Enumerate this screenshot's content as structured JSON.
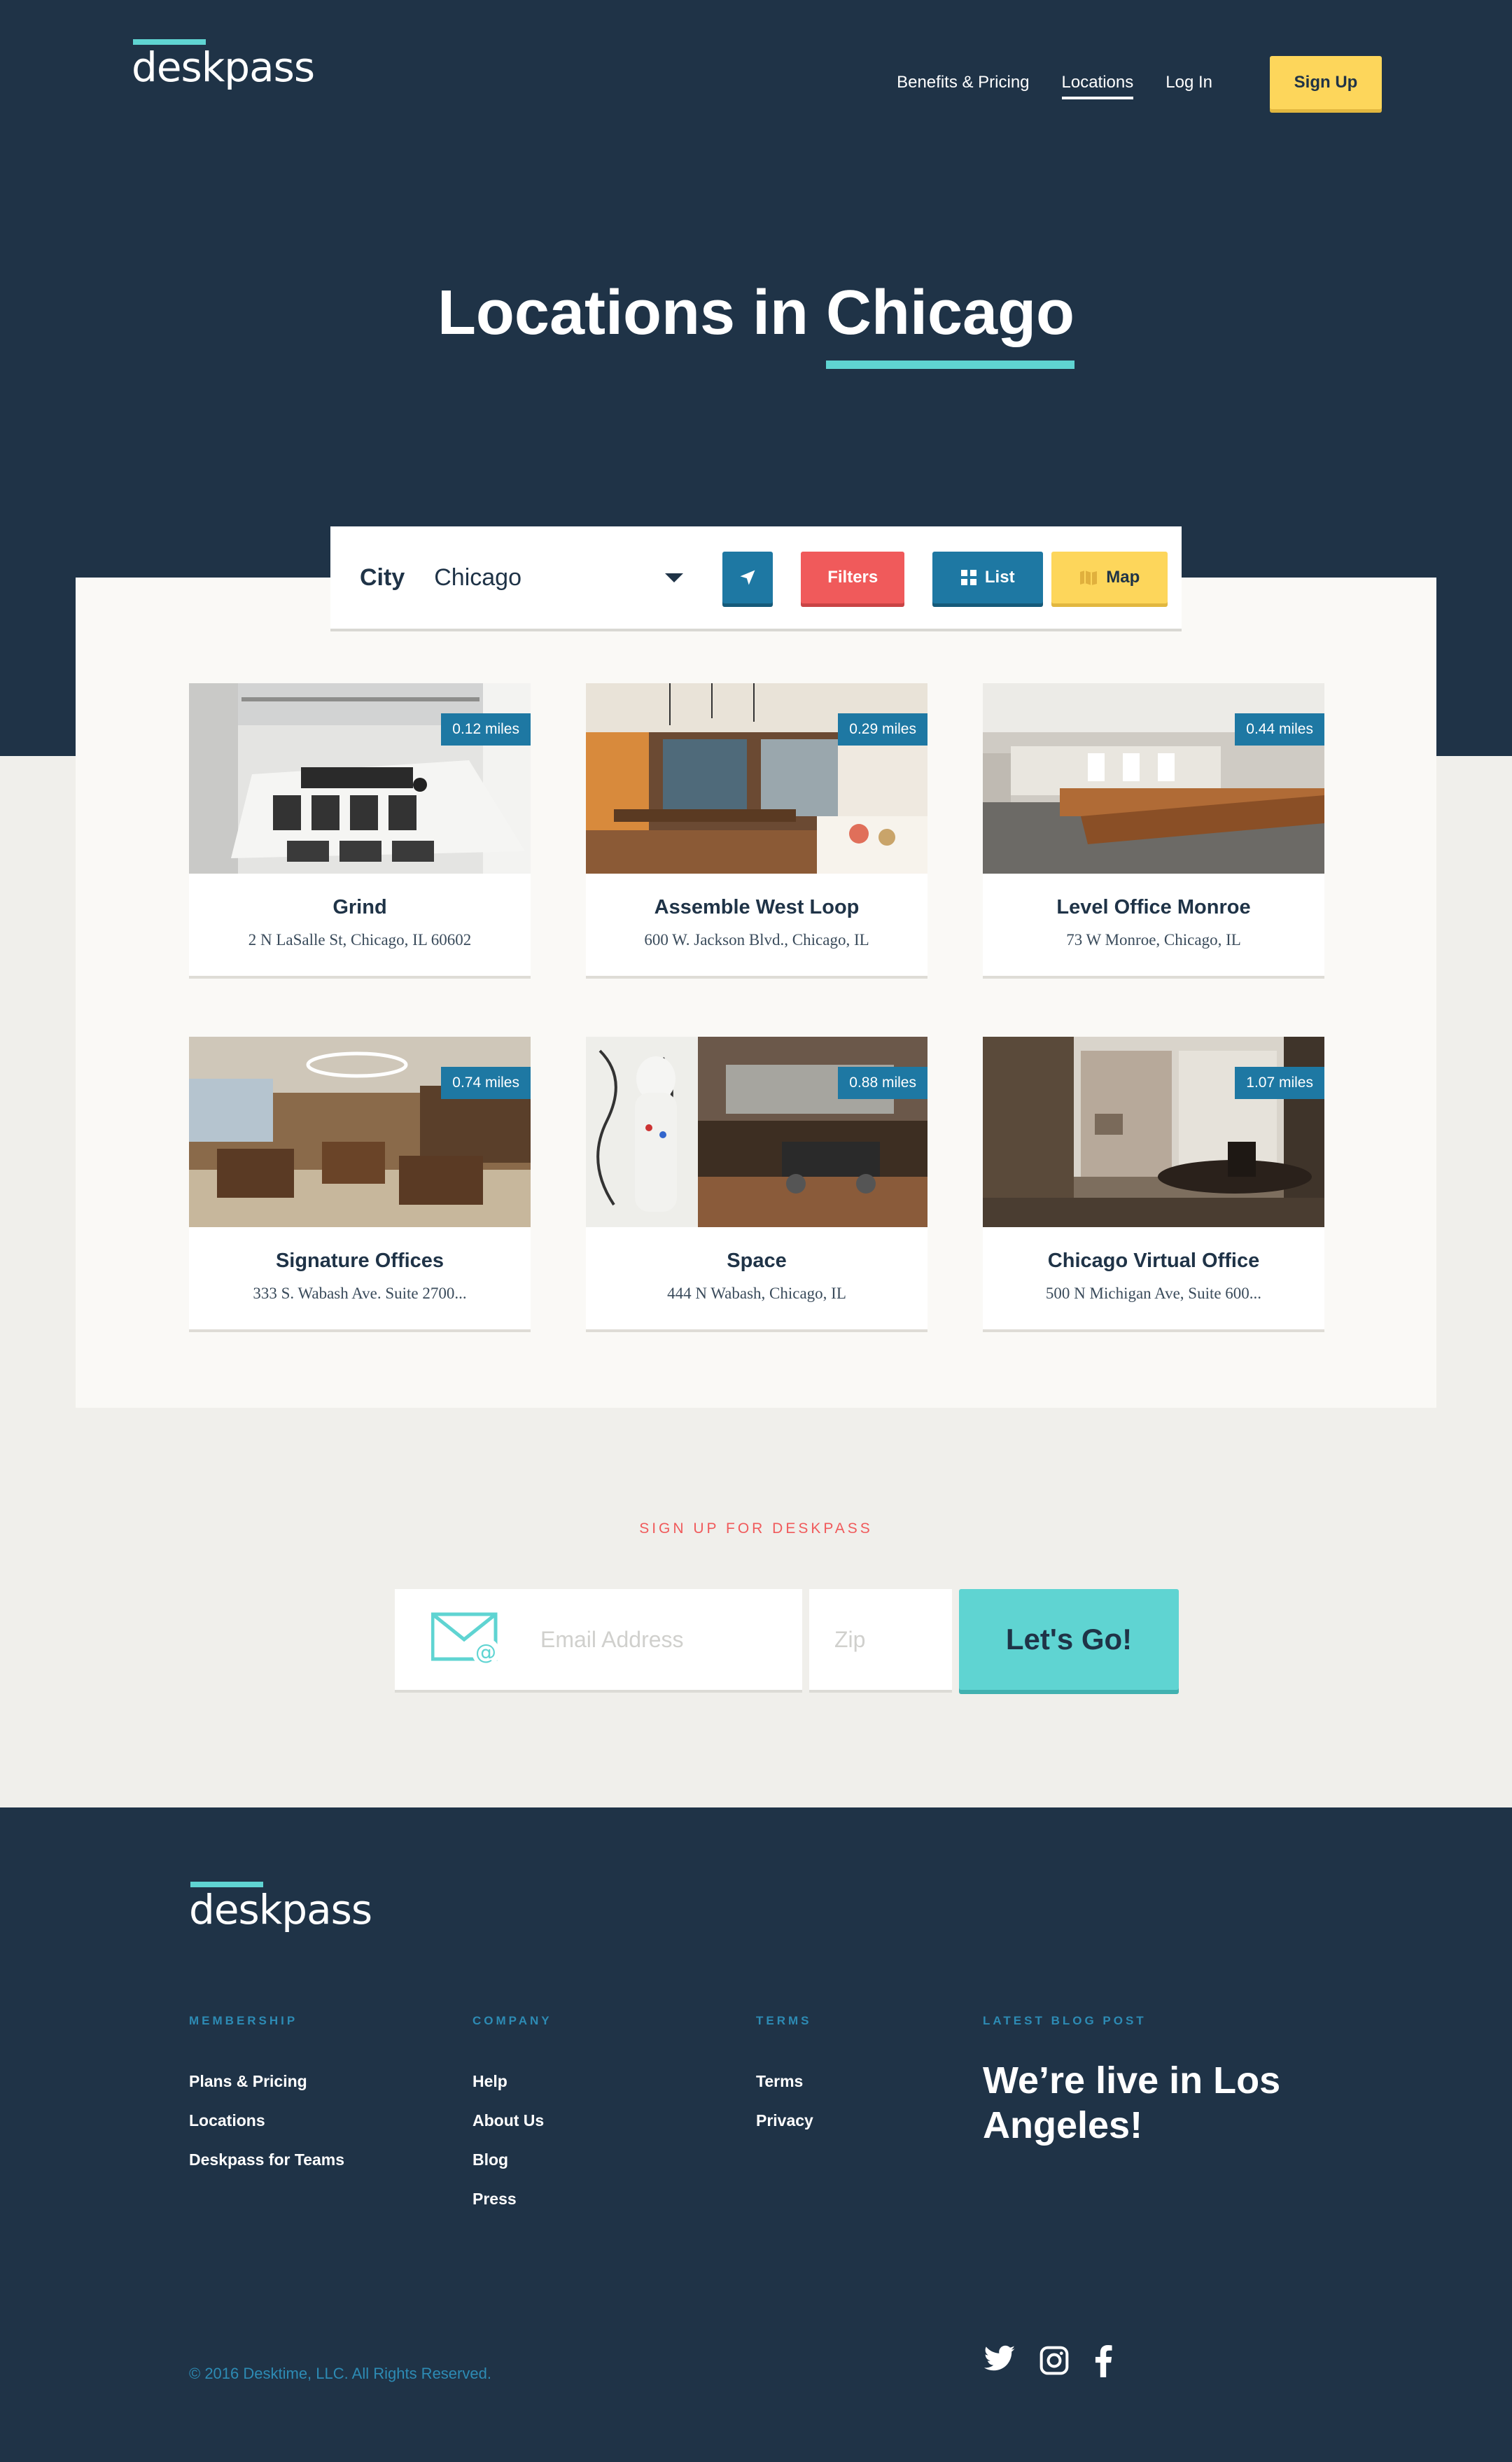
{
  "brand": {
    "logo": "deskpass"
  },
  "nav": {
    "benefits": "Benefits & Pricing",
    "locations": "Locations",
    "login": "Log In",
    "signup": "Sign Up"
  },
  "hero": {
    "title_prefix": "Locations in",
    "city": "Chicago"
  },
  "filters": {
    "city_label": "City",
    "city_value": "Chicago",
    "filters_label": "Filters",
    "list_label": "List",
    "map_label": "Map"
  },
  "locations": [
    {
      "name": "Grind",
      "address": "2 N LaSalle St, Chicago, IL 60602",
      "distance": "0.12 miles"
    },
    {
      "name": "Assemble West Loop",
      "address": "600 W. Jackson Blvd., Chicago, IL",
      "distance": "0.29 miles"
    },
    {
      "name": "Level Office Monroe",
      "address": "73 W Monroe, Chicago, IL",
      "distance": "0.44 miles"
    },
    {
      "name": "Signature Offices",
      "address": "333 S. Wabash Ave. Suite 2700...",
      "distance": "0.74 miles"
    },
    {
      "name": "Space",
      "address": "444 N Wabash, Chicago, IL",
      "distance": "0.88 miles"
    },
    {
      "name": "Chicago Virtual Office",
      "address": "500 N Michigan Ave, Suite 600...",
      "distance": "1.07 miles"
    }
  ],
  "signup": {
    "label": "SIGN UP FOR DESKPASS",
    "email_placeholder": "Email Address",
    "zip_placeholder": "Zip",
    "button": "Let's Go!"
  },
  "footer": {
    "logo": "deskpass",
    "membership": {
      "heading": "MEMBERSHIP",
      "links": [
        "Plans & Pricing",
        "Locations",
        "Deskpass for Teams"
      ]
    },
    "company": {
      "heading": "COMPANY",
      "links": [
        "Help",
        "About Us",
        "Blog",
        "Press"
      ]
    },
    "terms": {
      "heading": "TERMS",
      "links": [
        "Terms",
        "Privacy"
      ]
    },
    "blog": {
      "heading": "LATEST BLOG POST",
      "title": "We’re live in Los Angeles!"
    },
    "copyright": "© 2016 Desktime, LLC. All Rights Reserved.",
    "social_icons": [
      "twitter-icon",
      "instagram-icon",
      "facebook-icon"
    ]
  },
  "colors": {
    "navy": "#1f3347",
    "teal": "#5fd4d2",
    "blue": "#1e78a3",
    "red": "#f05a5b",
    "yellow": "#fdd65b"
  }
}
